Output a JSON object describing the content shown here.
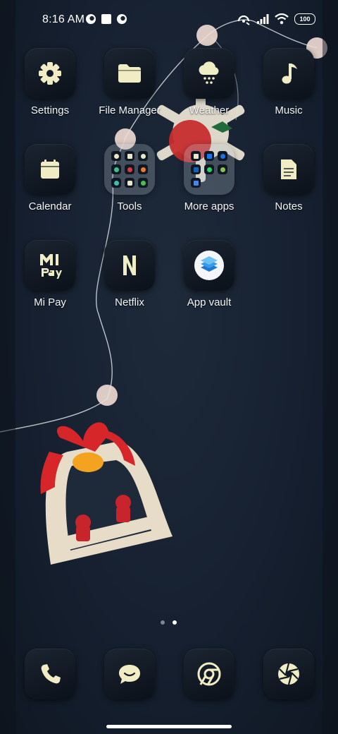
{
  "status_bar": {
    "time": "8:16 AM",
    "battery": "100"
  },
  "apps": {
    "settings": "Settings",
    "file_manager": "File Manager",
    "weather": "Weather",
    "music": "Music",
    "calendar": "Calendar",
    "tools": "Tools",
    "more_apps": "More apps",
    "notes": "Notes",
    "mi_pay": "Mi Pay",
    "netflix": "Netflix",
    "app_vault": "App vault"
  },
  "page_indicator": {
    "pages": 2,
    "active_page": 2
  },
  "dock": [
    "phone",
    "messaging",
    "browser",
    "camera"
  ],
  "colors": {
    "icon_glyph": "#f0ecc4",
    "tile_bg": "#131b26"
  }
}
